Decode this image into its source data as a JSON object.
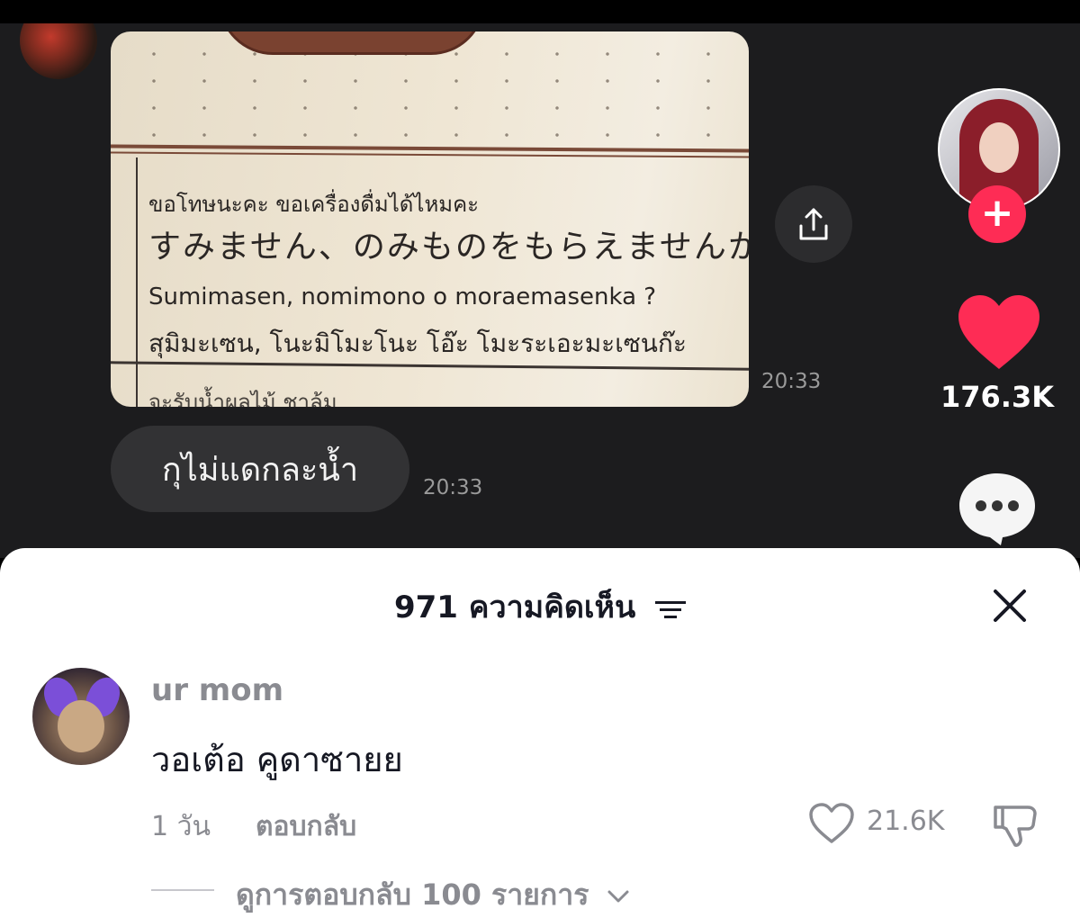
{
  "video": {
    "photo_lines": {
      "thai_title": "ขอโทษนะคะ ขอเครื่องดื่มได้ไหมคะ",
      "japanese": "すみません、のみものをもらえませんか",
      "romaji": "Sumimasen, nomimono o moraemasenka ?",
      "thai_reading": "สุมิมะเซน, โนะมิโมะโนะ โอ๊ะ โมะระเอะมะเซนก๊ะ",
      "cut_line": "จะรับน้ำผลไม้ ชาล้ม"
    },
    "photo_time": "20:33",
    "text_message": "กุไม่แดกละน้ำ",
    "text_time": "20:33"
  },
  "actions": {
    "share_icon": "share-icon",
    "follow_icon": "plus-icon",
    "like_count": "176.3K",
    "accent_color": "#fe2c55"
  },
  "comments_sheet": {
    "title": "971 ความคิดเห็น",
    "comment": {
      "username": "ur mom",
      "text": "วอเต้อ คูดาซายย",
      "age": "1 วัน",
      "reply_label": "ตอบกลับ",
      "like_count": "21.6K",
      "view_replies": "ดูการตอบกลับ 100 รายการ"
    }
  }
}
